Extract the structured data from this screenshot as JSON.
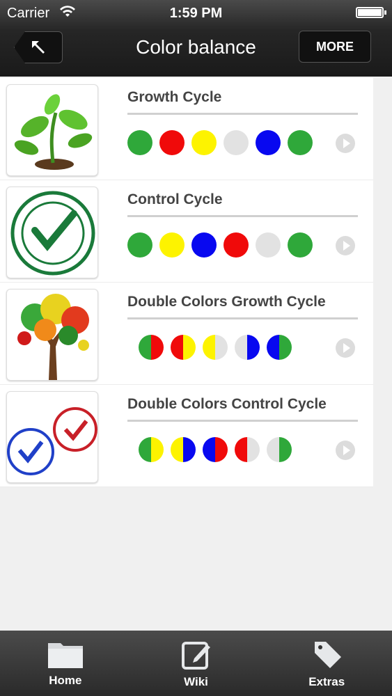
{
  "status": {
    "carrier": "Carrier",
    "time": "1:59 PM"
  },
  "nav": {
    "title": "Color balance",
    "more_label": "MORE",
    "back_icon": "back-arrow-icon"
  },
  "rows": [
    {
      "title": "Growth Cycle",
      "image": "plant-image",
      "dots": [
        [
          "#2fa83a",
          "#2fa83a"
        ],
        [
          "#f00a0a",
          "#f00a0a"
        ],
        [
          "#fdf300",
          "#fdf300"
        ],
        [
          "#e2e2e2",
          "#e2e2e2"
        ],
        [
          "#0808f0",
          "#0808f0"
        ],
        [
          "#2fa83a",
          "#2fa83a"
        ]
      ]
    },
    {
      "title": "Control Cycle",
      "image": "quality-control-stamp-image",
      "dots": [
        [
          "#2fa83a",
          "#2fa83a"
        ],
        [
          "#fdf300",
          "#fdf300"
        ],
        [
          "#0808f0",
          "#0808f0"
        ],
        [
          "#f00a0a",
          "#f00a0a"
        ],
        [
          "#e2e2e2",
          "#e2e2e2"
        ],
        [
          "#2fa83a",
          "#2fa83a"
        ]
      ]
    },
    {
      "title": "Double Colors Growth Cycle",
      "image": "colorful-tree-image",
      "dots": [
        [
          "#2fa83a",
          "#f00a0a"
        ],
        [
          "#f00a0a",
          "#fdf300"
        ],
        [
          "#fdf300",
          "#e2e2e2"
        ],
        [
          "#e2e2e2",
          "#0808f0"
        ],
        [
          "#0808f0",
          "#2fa83a"
        ]
      ]
    },
    {
      "title": "Double Colors Control Cycle",
      "image": "approved-stamps-image",
      "dots": [
        [
          "#2fa83a",
          "#fdf300"
        ],
        [
          "#fdf300",
          "#0808f0"
        ],
        [
          "#0808f0",
          "#f00a0a"
        ],
        [
          "#f00a0a",
          "#e2e2e2"
        ],
        [
          "#e2e2e2",
          "#2fa83a"
        ]
      ]
    }
  ],
  "tabs": [
    {
      "label": "Home",
      "icon": "folder-icon"
    },
    {
      "label": "Wiki",
      "icon": "edit-icon"
    },
    {
      "label": "Extras",
      "icon": "tags-icon"
    }
  ]
}
